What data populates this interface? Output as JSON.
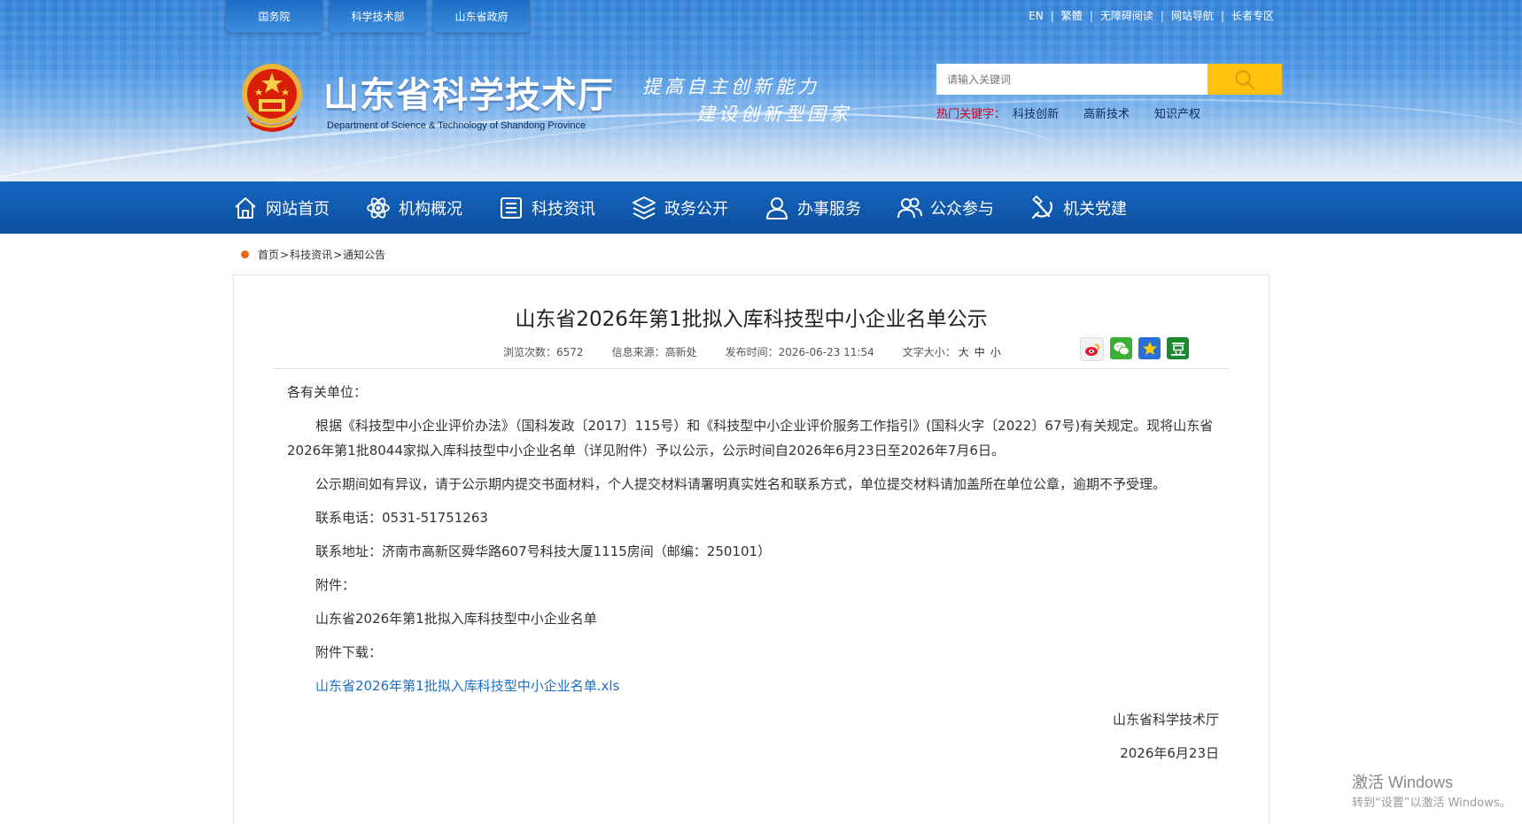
{
  "top_pills": [
    "国务院",
    "科学技术部",
    "山东省政府"
  ],
  "top_links": [
    "EN",
    "繁體",
    "无障碍阅读",
    "网站导航",
    "长者专区"
  ],
  "site": {
    "title": "山东省科学技术厅",
    "subtitle_en": "Department of Science & Technology of Shandong Province",
    "slogan_line1": "提高自主创新能力",
    "slogan_line2": "建设创新型国家"
  },
  "search": {
    "placeholder": "请输入关键词"
  },
  "hotkeys": {
    "label": "热门关键字：",
    "items": [
      "科技创新",
      "高新技术",
      "知识产权"
    ]
  },
  "nav": [
    "网站首页",
    "机构概况",
    "科技资讯",
    "政务公开",
    "办事服务",
    "公众参与",
    "机关党建"
  ],
  "breadcrumb": [
    "首页",
    "科技资讯",
    "通知公告"
  ],
  "article": {
    "title": "山东省2026年第1批拟入库科技型中小企业名单公示",
    "views_label": "浏览次数：",
    "views": "6572",
    "source_label": "信息来源：",
    "source": "高新处",
    "date_label": "发布时间：",
    "date": "2026-06-23 11:54",
    "font_label": "文字大小：",
    "font_sizes": [
      "大",
      "中",
      "小"
    ],
    "salutation": "各有关单位：",
    "para1": "根据《科技型中小企业评价办法》（国科发政〔2017〕115号）和《科技型中小企业评价服务工作指引》(国科火字〔2022〕67号)有关规定。现将山东省2026年第1批8044家拟入库科技型中小企业名单（详见附件）予以公示，公示时间自2026年6月23日至2026年7月6日。",
    "para2": "公示期间如有异议，请于公示期内提交书面材料，个人提交材料请署明真实姓名和联系方式，单位提交材料请加盖所在单位公章，逾期不予受理。",
    "phone": "联系电话：0531-51751263",
    "address": "联系地址：济南市高新区舜华路607号科技大厦1115房间（邮编：250101）",
    "attachment_label": "附件：",
    "attachment_name": "山东省2026年第1批拟入库科技型中小企业名单",
    "download_label": "附件下载：",
    "download_file": "山东省2026年第1批拟入库科技型中小企业名单.xls",
    "signature": "山东省科学技术厅",
    "sign_date": "2026年6月23日"
  },
  "share_icons": [
    "weibo-icon",
    "wechat-icon",
    "qzone-icon",
    "douban-icon"
  ],
  "watermark": {
    "line1": "激活 Windows",
    "line2": "转到“设置”以激活 Windows。"
  },
  "colors": {
    "nav_blue": "#1565c0",
    "search_btn": "#ffc20e",
    "hot_red": "#d0021b",
    "link_blue": "#1d6fc7",
    "dot_orange": "#e8681b"
  }
}
